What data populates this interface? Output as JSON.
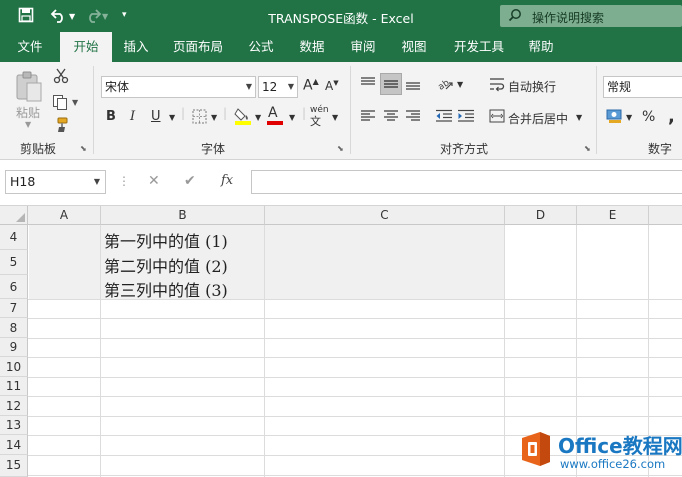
{
  "window": {
    "title": "TRANSPOSE函数  -  Excel"
  },
  "search": {
    "label": "操作说明搜索"
  },
  "colors": {
    "excel_green": "#217346",
    "ribbon_bg": "#f3f3f3",
    "watermark_orange": "#e8641b",
    "watermark_blue": "#1a78c2"
  },
  "tabs": [
    {
      "label": "文件"
    },
    {
      "label": "开始"
    },
    {
      "label": "插入"
    },
    {
      "label": "页面布局"
    },
    {
      "label": "公式"
    },
    {
      "label": "数据"
    },
    {
      "label": "审阅"
    },
    {
      "label": "视图"
    },
    {
      "label": "开发工具"
    },
    {
      "label": "帮助"
    }
  ],
  "ribbon": {
    "clipboard": {
      "paste_label": "粘贴",
      "group_label": "剪贴板"
    },
    "font": {
      "font_name": "宋体",
      "font_size": "12",
      "bold": "B",
      "italic": "I",
      "underline": "U",
      "grow": "A",
      "shrink": "A",
      "font_color": "A",
      "phonetic": "wén",
      "group_label": "字体"
    },
    "alignment": {
      "wrap_text": "自动换行",
      "merge_center": "合并后居中",
      "group_label": "对齐方式"
    },
    "number": {
      "format": "常规",
      "percent": "%",
      "comma": ",",
      "group_label": "数字"
    }
  },
  "formula_bar": {
    "name_box": "H18",
    "cancel": "✕",
    "enter": "✔",
    "fx": "fx",
    "formula": ""
  },
  "sheet": {
    "columns": [
      "A",
      "B",
      "C",
      "D",
      "E"
    ],
    "rows": [
      "4",
      "5",
      "6",
      "7",
      "8",
      "9",
      "10",
      "11",
      "12",
      "13",
      "14",
      "15"
    ],
    "cells": [
      {
        "ref": "B4",
        "value": "第一列中的值 (1)"
      },
      {
        "ref": "B5",
        "value": "第二列中的值 (2)"
      },
      {
        "ref": "B6",
        "value": "第三列中的值 (3)"
      }
    ]
  },
  "watermark": {
    "brand": "Office教程网",
    "url": "www.office26.com"
  }
}
